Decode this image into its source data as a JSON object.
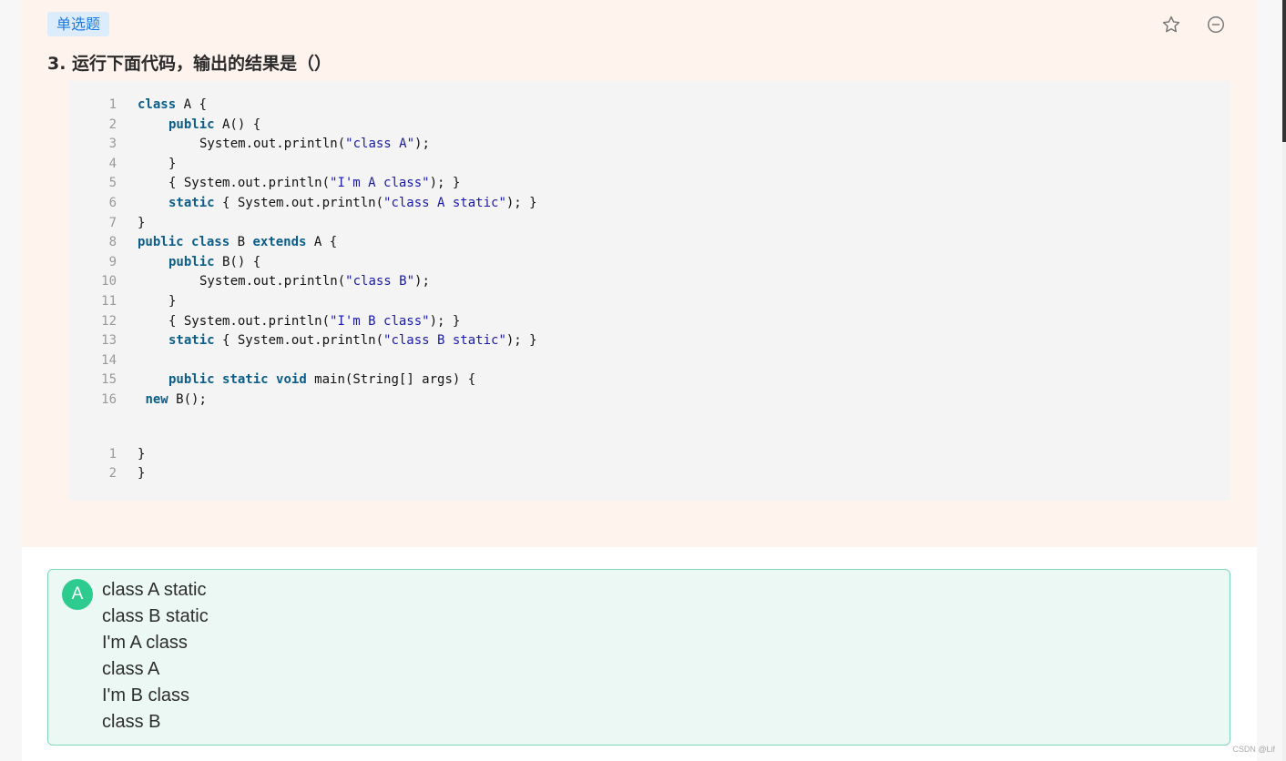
{
  "question": {
    "tag": "单选题",
    "title": "3. 运行下面代码，输出的结果是（）",
    "icons": [
      "star-icon",
      "minus-circle-icon"
    ]
  },
  "code_lines": [
    {
      "ln": "1",
      "indent": 0,
      "tokens": [
        [
          "kw",
          "class"
        ],
        [
          "t",
          " A {"
        ]
      ]
    },
    {
      "ln": "2",
      "indent": 1,
      "tokens": [
        [
          "kw",
          "public"
        ],
        [
          "t",
          " A() {"
        ]
      ]
    },
    {
      "ln": "3",
      "indent": 2,
      "tokens": [
        [
          "t",
          "System.out.println("
        ],
        [
          "str",
          "\"class A\""
        ],
        [
          "t",
          ");"
        ]
      ]
    },
    {
      "ln": "4",
      "indent": 1,
      "tokens": [
        [
          "t",
          "}"
        ]
      ]
    },
    {
      "ln": "5",
      "indent": 1,
      "tokens": [
        [
          "t",
          "{ System.out.println("
        ],
        [
          "str",
          "\"I'm A class\""
        ],
        [
          "t",
          "); }"
        ]
      ]
    },
    {
      "ln": "6",
      "indent": 1,
      "tokens": [
        [
          "kw",
          "static"
        ],
        [
          "t",
          " { System.out.println("
        ],
        [
          "str",
          "\"class A static\""
        ],
        [
          "t",
          "); }"
        ]
      ]
    },
    {
      "ln": "7",
      "indent": 0,
      "tokens": [
        [
          "t",
          "}"
        ]
      ]
    },
    {
      "ln": "8",
      "indent": 0,
      "tokens": [
        [
          "kw",
          "public"
        ],
        [
          "t",
          " "
        ],
        [
          "kw",
          "class"
        ],
        [
          "t",
          " B "
        ],
        [
          "kw",
          "extends"
        ],
        [
          "t",
          " A {"
        ]
      ]
    },
    {
      "ln": "9",
      "indent": 1,
      "tokens": [
        [
          "kw",
          "public"
        ],
        [
          "t",
          " B() {"
        ]
      ]
    },
    {
      "ln": "10",
      "indent": 2,
      "tokens": [
        [
          "t",
          "System.out.println("
        ],
        [
          "str",
          "\"class B\""
        ],
        [
          "t",
          ");"
        ]
      ]
    },
    {
      "ln": "11",
      "indent": 1,
      "tokens": [
        [
          "t",
          "}"
        ]
      ]
    },
    {
      "ln": "12",
      "indent": 1,
      "tokens": [
        [
          "t",
          "{ System.out.println("
        ],
        [
          "str",
          "\"I'm B class\""
        ],
        [
          "t",
          "); }"
        ]
      ]
    },
    {
      "ln": "13",
      "indent": 1,
      "tokens": [
        [
          "kw",
          "static"
        ],
        [
          "t",
          " { System.out.println("
        ],
        [
          "str",
          "\"class B static\""
        ],
        [
          "t",
          "); }"
        ]
      ]
    },
    {
      "ln": "14",
      "indent": 0,
      "tokens": []
    },
    {
      "ln": "15",
      "indent": 1,
      "tokens": [
        [
          "kw",
          "public"
        ],
        [
          "t",
          " "
        ],
        [
          "kw",
          "static"
        ],
        [
          "t",
          " "
        ],
        [
          "kw",
          "void"
        ],
        [
          "t",
          " main(String[] args) {"
        ]
      ]
    },
    {
      "ln": "16",
      "indent": 0,
      "tokens": [
        [
          "t",
          " "
        ],
        [
          "kw",
          "new"
        ],
        [
          "t",
          " B();"
        ]
      ]
    },
    {
      "ln": "1",
      "indent": 0,
      "tokens": [
        [
          "t",
          "}"
        ]
      ]
    },
    {
      "ln": "2",
      "indent": 0,
      "tokens": [
        [
          "t",
          "}"
        ]
      ]
    }
  ],
  "option": {
    "letter": "A",
    "lines": [
      "class A static",
      "class B static",
      "I'm A class",
      "class A",
      "I'm B class",
      "class B"
    ]
  },
  "watermark": "CSDN @Lif",
  "colors": {
    "keyword": "#0b5d8a",
    "string": "#1a1aa6",
    "option_accent": "#2ecb8e",
    "tag_text": "#1f7ae0"
  }
}
